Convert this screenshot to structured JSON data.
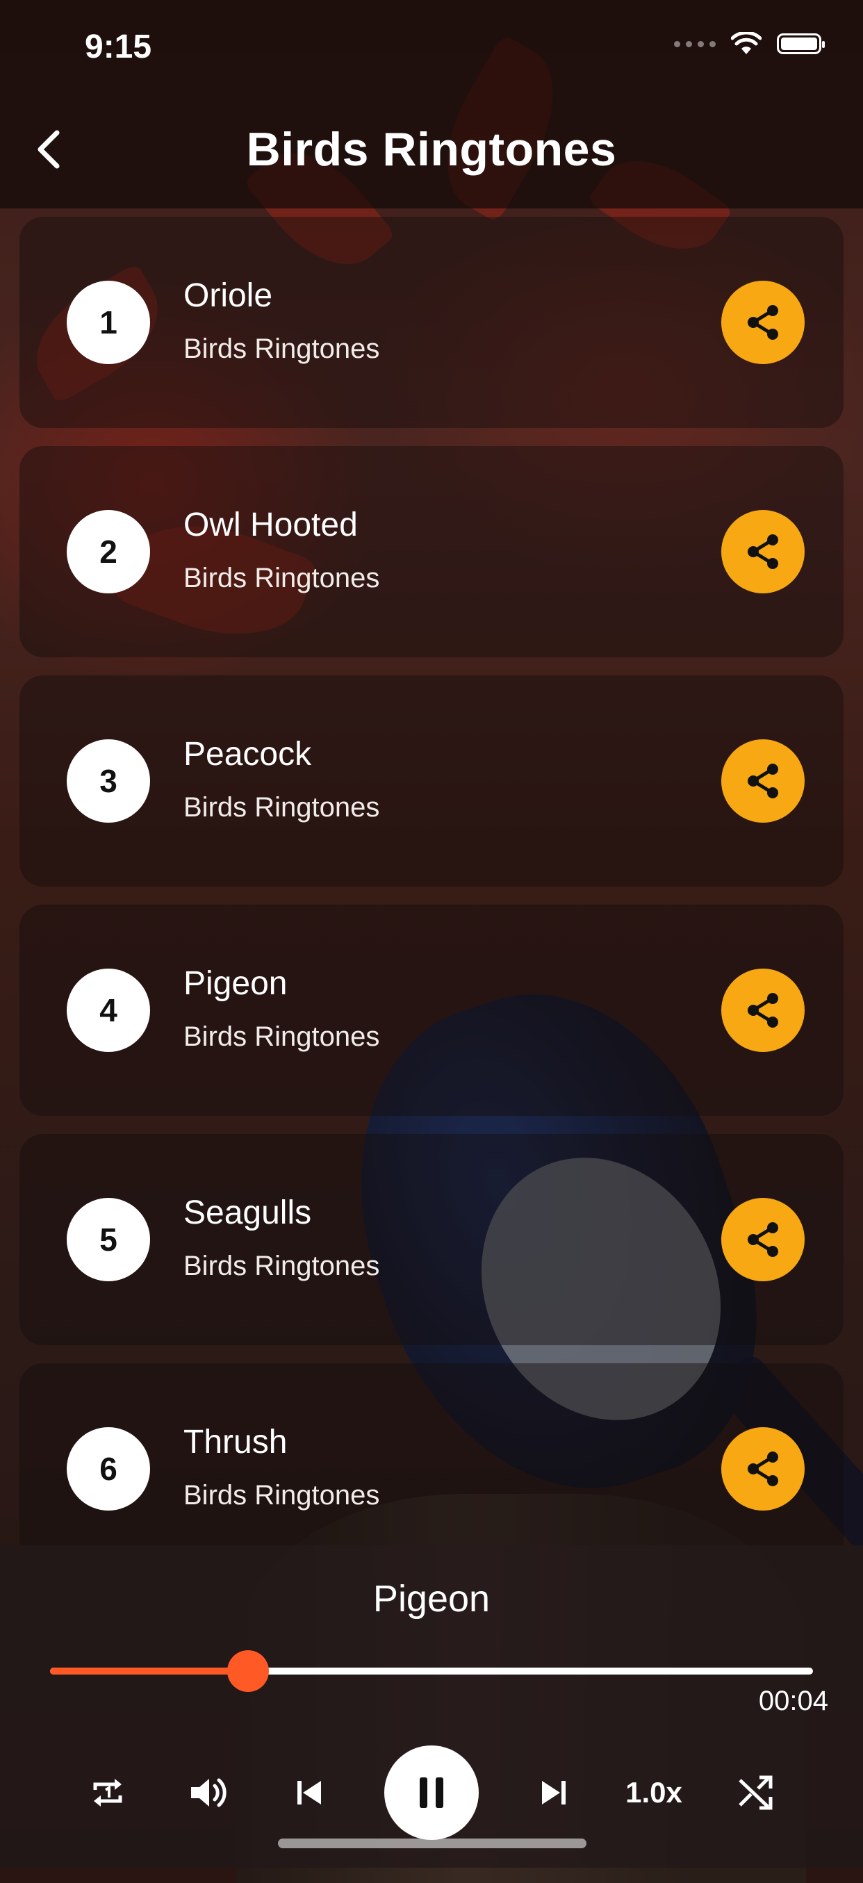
{
  "status_bar": {
    "time": "9:15"
  },
  "header": {
    "title": "Birds Ringtones"
  },
  "ringtones": [
    {
      "number": "1",
      "title": "Oriole",
      "subtitle": "Birds Ringtones"
    },
    {
      "number": "2",
      "title": "Owl Hooted",
      "subtitle": "Birds Ringtones"
    },
    {
      "number": "3",
      "title": "Peacock",
      "subtitle": "Birds Ringtones"
    },
    {
      "number": "4",
      "title": "Pigeon",
      "subtitle": "Birds Ringtones"
    },
    {
      "number": "5",
      "title": "Seagulls",
      "subtitle": "Birds Ringtones"
    },
    {
      "number": "6",
      "title": "Thrush",
      "subtitle": "Birds Ringtones"
    }
  ],
  "player": {
    "now_playing": "Pigeon",
    "elapsed": "00:04",
    "progress_fraction": 0.26,
    "speed_label": "1.0x"
  },
  "colors": {
    "accent_share": "#f7a812",
    "accent_progress": "#ff5a26"
  },
  "icons": {
    "back": "chevron-left-icon",
    "share": "share-icon",
    "repeat": "repeat-one-icon",
    "volume": "volume-icon",
    "previous": "skip-previous-icon",
    "pause": "pause-icon",
    "next": "skip-next-icon",
    "shuffle": "shuffle-icon"
  }
}
